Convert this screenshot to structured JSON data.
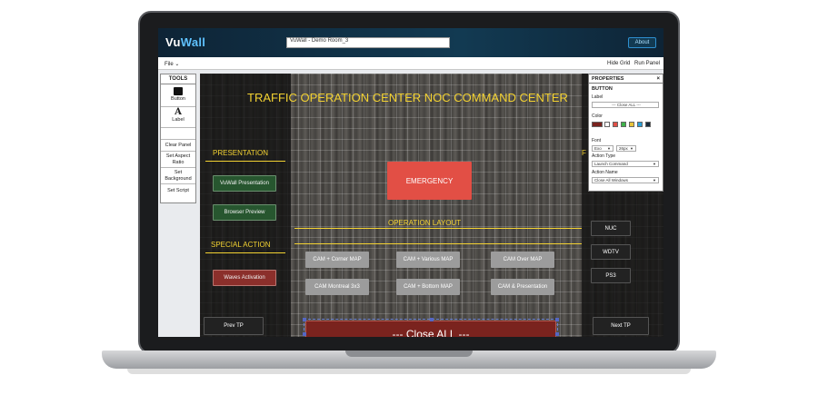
{
  "app": {
    "logo_text_a": "Vu",
    "logo_text_b": "Wall",
    "room_name": "VuWall - Demo Room_3",
    "about_label": "About"
  },
  "menubar": {
    "file_label": "File",
    "hide_grid_label": "Hide Grid",
    "run_panel_label": "Run Panel"
  },
  "tools": {
    "title": "TOOLS",
    "items": [
      {
        "label": "Button",
        "icon": "square-icon"
      },
      {
        "label": "Label",
        "icon": "letter-a-icon",
        "glyph": "A"
      }
    ],
    "actions": [
      "Clear Panel",
      "Set Aspect Ratio",
      "Set Background",
      "Set Script"
    ]
  },
  "canvas": {
    "title": "TRAFFIC OPERATION CENTER   NOC COMMAND CENTER",
    "presentation_header": "PRESENTATION",
    "special_action_header": "SPECIAL ACTION",
    "operation_layout_header": "OPERATION LAYOUT",
    "right_header_fragment": "F",
    "presentation_buttons": [
      "VuWall Presentation",
      "Browser Preview"
    ],
    "special_buttons": [
      "Waves Activation"
    ],
    "emergency_label": "EMERGENCY",
    "layout_buttons": [
      "CAM + Corner MAP",
      "CAM + Various MAP",
      "CAM Over MAP",
      "CAM Montreal 3x3",
      "CAM + Bottom MAP",
      "CAM & Presentation"
    ],
    "right_buttons": [
      "NUC",
      "WDTV",
      "PS3"
    ],
    "close_all_label": "--- Close ALL ---",
    "prev_label": "Prev TP",
    "next_label": "Next TP"
  },
  "properties": {
    "title": "PROPERTIES",
    "close_glyph": "×",
    "section": "BUTTON",
    "label_caption": "Label",
    "label_value": "--- Close ALL ---",
    "color_caption": "Color",
    "swatch_colors": [
      "#7a231e",
      "#ffffff",
      "#e24f45",
      "#3fb24a",
      "#e8c43a",
      "#2aa0d8",
      "#1b2a3a"
    ],
    "font_caption": "Font",
    "font_value": "Exo",
    "font_size_value": "26px",
    "action_type_caption": "Action Type",
    "action_type_value": "Launch Command",
    "action_name_caption": "Action Name",
    "action_name_value": "Close All Windows"
  }
}
